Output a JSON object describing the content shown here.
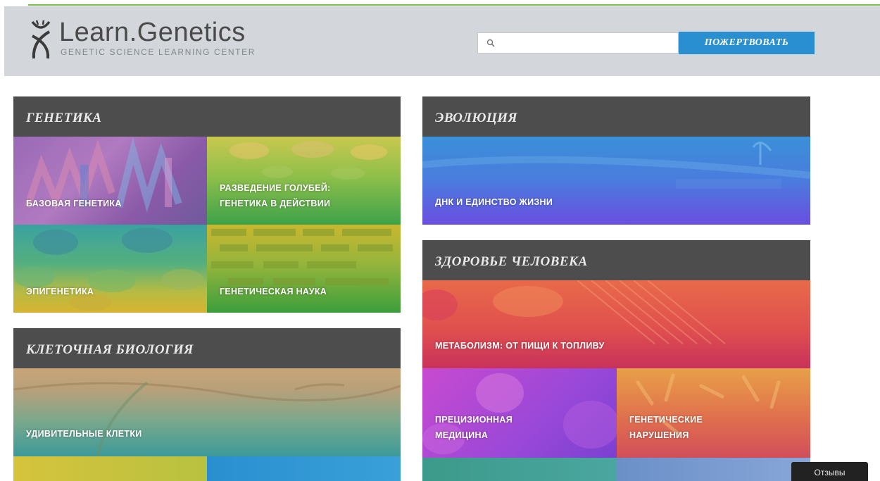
{
  "header": {
    "logo_title": "Learn.Genetics",
    "logo_subtitle": "GENETIC SCIENCE LEARNING CENTER",
    "search_placeholder": "",
    "donate_label": "ПОЖЕРТВОВАТЬ"
  },
  "panels": {
    "genetics": {
      "title": "ГЕНЕТИКА",
      "tiles": [
        "БАЗОВАЯ ГЕНЕТИКА",
        "РАЗВЕДЕНИЕ ГОЛУБЕЙ:\nГЕНЕТИКА В ДЕЙСТВИИ",
        "ЭПИГЕНЕТИКА",
        "ГЕНЕТИЧЕСКАЯ НАУКА"
      ]
    },
    "evolution": {
      "title": "ЭВОЛЮЦИЯ",
      "tiles": [
        "ДНК И ЕДИНСТВО ЖИЗНИ"
      ]
    },
    "cell_biology": {
      "title": "КЛЕТОЧНАЯ БИОЛОГИЯ",
      "tiles": [
        "УДИВИТЕЛЬНЫЕ КЛЕТКИ"
      ]
    },
    "human_health": {
      "title": "ЗДОРОВЬЕ ЧЕЛОВЕКА",
      "tiles": [
        "МЕТАБОЛИЗМ: ОТ ПИЩИ К ТОПЛИВУ",
        "ПРЕЦИЗИОННАЯ\nМЕДИЦИНА",
        "ГЕНЕТИЧЕСКИЕ\nНАРУШЕНИЯ"
      ]
    }
  },
  "feedback_label": "Отзывы",
  "colors": {
    "header_bg": "#d3d7db",
    "panel_head": "#4d4d4d",
    "donate": "#2a8fd0",
    "accent_green": "#74c04a"
  },
  "icons": [
    "dna-logo-icon",
    "search-icon"
  ]
}
